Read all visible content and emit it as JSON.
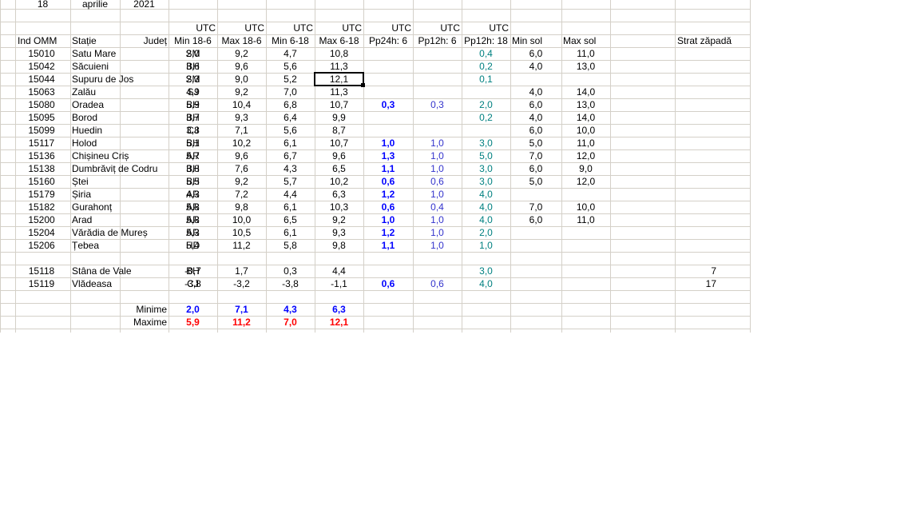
{
  "header": {
    "day": "18",
    "month": "aprilie",
    "year": "2021",
    "utc_label": "UTC"
  },
  "columns": [
    "Ind OMM",
    "Stație",
    "Județ",
    "Min 18-6",
    "Max 18-6",
    "Min 6-18",
    "Max 6-18",
    "Pp24h: 6",
    "Pp12h: 6",
    "Pp12h: 18",
    "Min sol",
    "Max sol",
    "Strat zăpadă"
  ],
  "rows": [
    [
      "15010",
      "Satu Mare",
      "SM",
      "2,0",
      "9,2",
      "4,7",
      "10,8",
      "",
      "",
      "0,4",
      "6,0",
      "11,0",
      ""
    ],
    [
      "15042",
      "Săcuieni",
      "BH",
      "3,6",
      "9,6",
      "5,6",
      "11,3",
      "",
      "",
      "0,2",
      "4,0",
      "13,0",
      ""
    ],
    [
      "15044",
      "Supuru de Jos",
      "SM",
      "2,3",
      "9,0",
      "5,2",
      "12,1",
      "",
      "",
      "0,1",
      "",
      "",
      ""
    ],
    [
      "15063",
      "Zalău",
      "SJ",
      "4,9",
      "9,2",
      "7,0",
      "11,3",
      "",
      "",
      "",
      "4,0",
      "14,0",
      ""
    ],
    [
      "15080",
      "Oradea",
      "BH",
      "5,9",
      "10,4",
      "6,8",
      "10,7",
      "0,3",
      "0,3",
      "2,0",
      "6,0",
      "13,0",
      ""
    ],
    [
      "15095",
      "Borod",
      "BH",
      "3,7",
      "9,3",
      "6,4",
      "9,9",
      "",
      "",
      "0,2",
      "4,0",
      "14,0",
      ""
    ],
    [
      "15099",
      "Huedin",
      "CJ",
      "3,8",
      "7,1",
      "5,6",
      "8,7",
      "",
      "",
      "",
      "6,0",
      "10,0",
      ""
    ],
    [
      "15117",
      "Holod",
      "BH",
      "5,1",
      "10,2",
      "6,1",
      "10,7",
      "1,0",
      "1,0",
      "3,0",
      "5,0",
      "11,0",
      ""
    ],
    [
      "15136",
      "Chișineu   Criș",
      "AR",
      "5,7",
      "9,6",
      "6,7",
      "9,6",
      "1,3",
      "1,0",
      "5,0",
      "7,0",
      "12,0",
      ""
    ],
    [
      "15138",
      "Dumbrăviț  de Codru",
      "BH",
      "3,8",
      "7,6",
      "4,3",
      "6,5",
      "1,1",
      "1,0",
      "3,0",
      "6,0",
      "9,0",
      ""
    ],
    [
      "15160",
      "Ștei",
      "BH",
      "5,5",
      "9,2",
      "5,7",
      "10,2",
      "0,6",
      "0,6",
      "3,0",
      "5,0",
      "12,0",
      ""
    ],
    [
      "15179",
      "Șiria",
      "AR",
      "4,3",
      "7,2",
      "4,4",
      "6,3",
      "1,2",
      "1,0",
      "4,0",
      "",
      "",
      ""
    ],
    [
      "15182",
      "Gurahonț",
      "AR",
      "5,8",
      "9,8",
      "6,1",
      "10,3",
      "0,6",
      "0,4",
      "4,0",
      "7,0",
      "10,0",
      ""
    ],
    [
      "15200",
      "Arad",
      "AR",
      "5,8",
      "10,0",
      "6,5",
      "9,2",
      "1,0",
      "1,0",
      "4,0",
      "6,0",
      "11,0",
      ""
    ],
    [
      "15204",
      "Vărădia de Mureș",
      "AR",
      "5,3",
      "10,5",
      "6,1",
      "9,3",
      "1,2",
      "1,0",
      "2,0",
      "",
      "",
      ""
    ],
    [
      "15206",
      "Țebea",
      "HD",
      "5,4",
      "11,2",
      "5,8",
      "9,8",
      "1,1",
      "1,0",
      "1,0",
      "",
      "",
      ""
    ],
    null,
    [
      "15118",
      "Stâna de Vale",
      "BH",
      "-0,7",
      "1,7",
      "0,3",
      "4,4",
      "",
      "",
      "3,0",
      "",
      "",
      "7"
    ],
    [
      "15119",
      "Vlădeasa",
      "CJ",
      "-3,8",
      "-3,2",
      "-3,8",
      "-1,1",
      "0,6",
      "0,6",
      "4,0",
      "",
      "",
      "17"
    ]
  ],
  "summary": {
    "minime": {
      "label": "Minime",
      "values": [
        "2,0",
        "7,1",
        "4,3",
        "6,3"
      ]
    },
    "maxime": {
      "label": "Maxime",
      "values": [
        "5,9",
        "11,2",
        "7,0",
        "12,1"
      ]
    }
  },
  "selected_cell": {
    "row": 3,
    "col": 7
  },
  "colors": {
    "grid": "#d4d0c8",
    "pp24": "#0000ff",
    "pp12_6": "#3333cc",
    "pp12_18": "#008080",
    "max_red": "#ff0000",
    "min_blue": "#0000ff"
  }
}
